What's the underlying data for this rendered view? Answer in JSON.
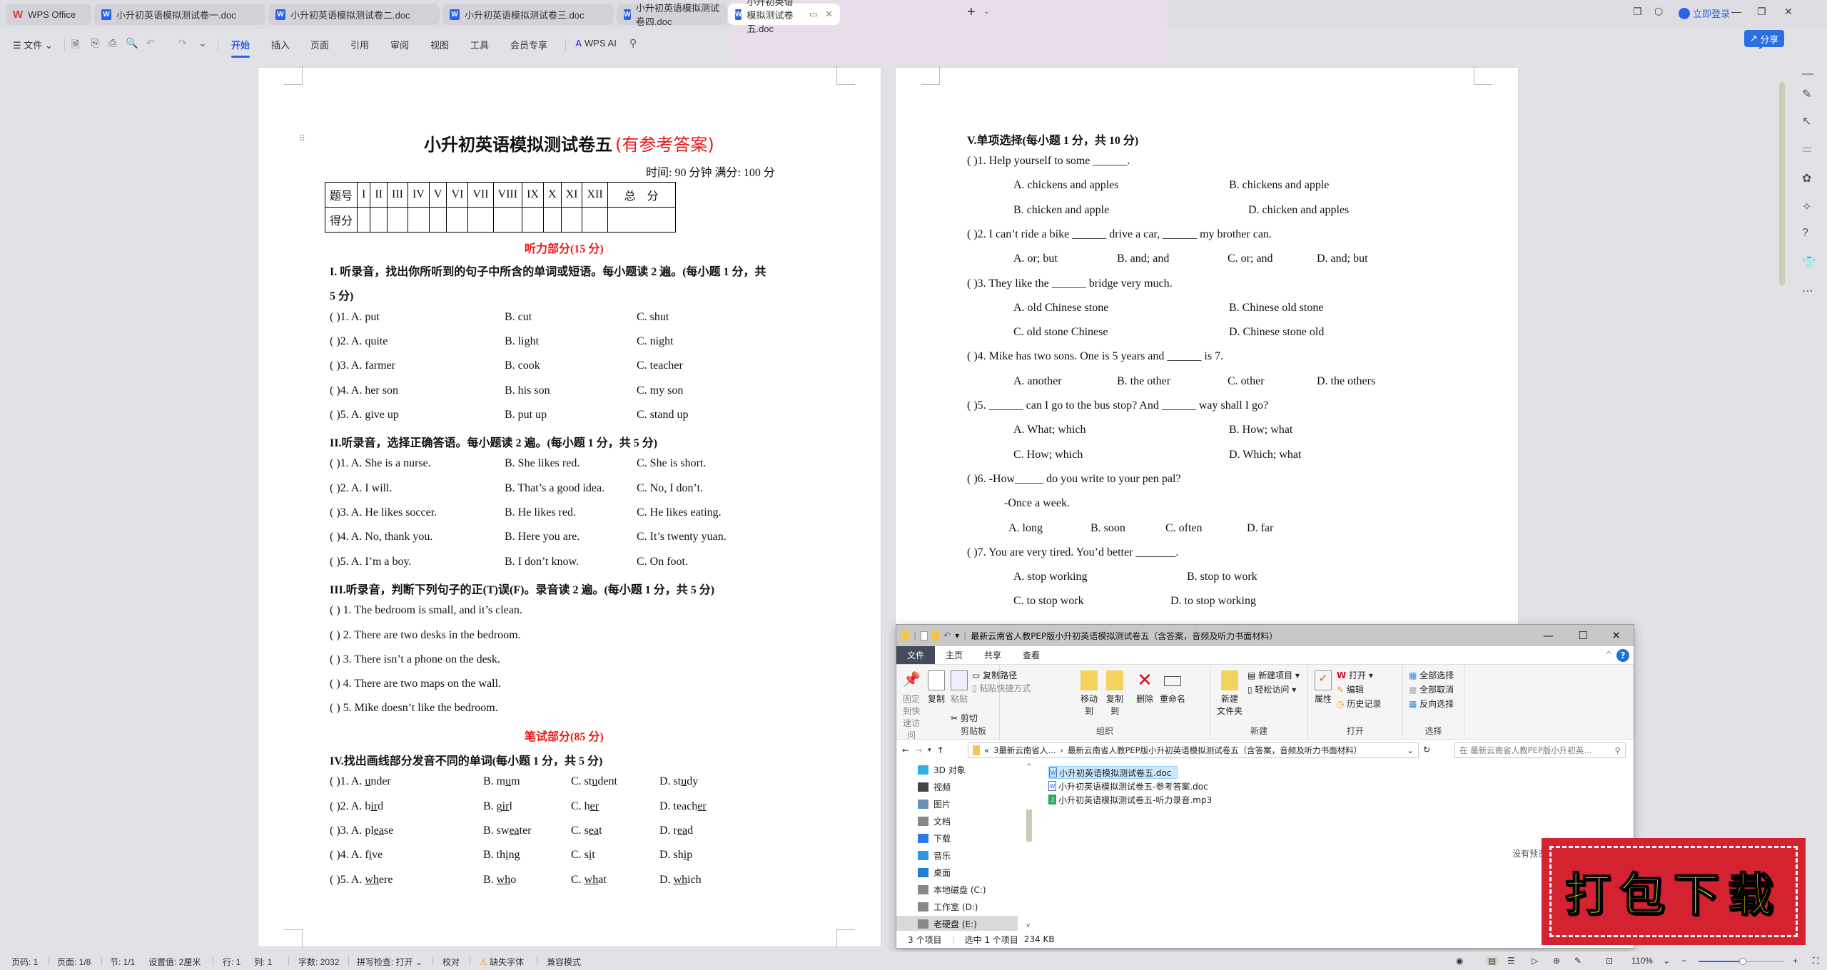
{
  "app": {
    "name": "WPS Office",
    "tabs": [
      {
        "label": "小升初英语模拟测试卷一.doc",
        "active": false
      },
      {
        "label": "小升初英语模拟测试卷二.doc",
        "active": false
      },
      {
        "label": "小升初英语模拟测试卷三.doc",
        "active": false
      },
      {
        "label": "小升初英语模拟测试卷四.doc",
        "active": false
      },
      {
        "label": "小升初英语模拟测试卷五.doc",
        "active": true
      }
    ],
    "login_label": "立即登录"
  },
  "ribbon": {
    "file_menu": "文件",
    "tabs": [
      "开始",
      "插入",
      "页面",
      "引用",
      "审阅",
      "视图",
      "工具",
      "会员专享"
    ],
    "active_tab": "开始",
    "wps_ai": "WPS AI",
    "share": "分享"
  },
  "doc": {
    "title": "小升初英语模拟测试卷五",
    "title_note": "(有参考答案)",
    "meta": "时间: 90 分钟      满分: 100 分",
    "score_table": {
      "row1": [
        "题号",
        "I",
        "II",
        "III",
        "IV",
        "V",
        "VI",
        "VII",
        "VIII",
        "IX",
        "X",
        "XI",
        "XII",
        "总　分"
      ],
      "row2_label": "得分"
    },
    "listening_header": "听力部分(15 分)",
    "sec1": {
      "heading_line1": "I. 听录音，找出你所听到的句子中所含的单词或短语。每小题读 2 遍。(每小题 1 分，共",
      "heading_line2": "5 分)",
      "items": [
        {
          "q": "(      )1. A. put",
          "b": "B. cut",
          "c": "C. shut"
        },
        {
          "q": "(      )2. A. quite",
          "b": "B. light",
          "c": "C. night"
        },
        {
          "q": "(      )3. A. farmer",
          "b": "B. cook",
          "c": "C. teacher"
        },
        {
          "q": "(      )4. A. her son",
          "b": "B. his son",
          "c": "C. my son"
        },
        {
          "q": "(      )5. A. give up",
          "b": "B. put up",
          "c": "C. stand up"
        }
      ]
    },
    "sec2": {
      "heading": "II.听录音，选择正确答语。每小题读 2 遍。(每小题 1 分，共 5 分)",
      "items": [
        {
          "q": "(      )1. A. She is a nurse.",
          "b": "B. She likes red.",
          "c": "C. She is short."
        },
        {
          "q": "(      )2. A. I will.",
          "b": "B. That’s a good idea.",
          "c": "C. No, I don’t."
        },
        {
          "q": "(      )3. A. He likes soccer.",
          "b": "B. He likes red.",
          "c": "C. He likes eating."
        },
        {
          "q": "(      )4. A. No, thank you.",
          "b": "B. Here you are.",
          "c": "C. It’s twenty yuan."
        },
        {
          "q": "(      )5. A. I’m a boy.",
          "b": "B. I don’t know.",
          "c": "C. On foot."
        }
      ]
    },
    "sec3": {
      "heading": "III.听录音，判断下列句子的正(T)误(F)。录音读 2 遍。(每小题 1 分，共 5 分)",
      "items": [
        "(      ) 1. The bedroom is small, and it’s clean.",
        "(      ) 2. There are two desks in the bedroom.",
        "(      ) 3. There isn’t a phone on the desk.",
        "(      ) 4. There are two maps on the wall.",
        "(      ) 5. Mike doesn’t like the bedroom."
      ]
    },
    "written_header": "笔试部分(85 分)",
    "sec4": {
      "heading": "IV.找出画线部分发音不同的单词(每小题 1 分，共 5 分)",
      "items": [
        {
          "q": "(      )1. A. ",
          "a": [
            "",
            "u",
            "nder"
          ],
          "b": [
            "B. m",
            "u",
            "m"
          ],
          "c": [
            "C. st",
            "u",
            "dent"
          ],
          "d": [
            "D. st",
            "u",
            "dy"
          ]
        },
        {
          "q": "(      )2. A. ",
          "a": [
            "b",
            "ir",
            "d"
          ],
          "b": [
            "B. g",
            "ir",
            "l"
          ],
          "c": [
            "C. h",
            "er",
            ""
          ],
          "d": [
            "D. teach",
            "er",
            ""
          ]
        },
        {
          "q": "(      )3. A. ",
          "a": [
            "pl",
            "ea",
            "se"
          ],
          "b": [
            "B. sw",
            "ea",
            "ter"
          ],
          "c": [
            "C. s",
            "ea",
            "t"
          ],
          "d": [
            "D. r",
            "ea",
            "d"
          ]
        },
        {
          "q": "(      )4. A. ",
          "a": [
            "f",
            "i",
            "ve"
          ],
          "b": [
            "B. th",
            "i",
            "ng"
          ],
          "c": [
            "C. s",
            "i",
            "t"
          ],
          "d": [
            "D. sh",
            "i",
            "p"
          ]
        },
        {
          "q": "(      )5. A. ",
          "a": [
            "",
            "wh",
            "ere"
          ],
          "b": [
            "B. ",
            "wh",
            "o"
          ],
          "c": [
            "C. ",
            "wh",
            "at"
          ],
          "d": [
            "D. ",
            "wh",
            "ich"
          ]
        }
      ]
    },
    "sec5": {
      "heading": "V.单项选择(每小题 1 分，共 10 分)",
      "lines": [
        {
          "t": "(      )1. Help yourself to some ______.",
          "indent": 0
        },
        {
          "t": "A.  chickens and apples",
          "t2": "B. chickens and apple",
          "indent": 1
        },
        {
          "t": "B.  chicken and apple",
          "t2": "D. chicken and apples",
          "indent": 1,
          "shift": true
        },
        {
          "t": "(      )2. I can’t ride a bike ______ drive a car, ______ my brother can.",
          "indent": 0
        },
        {
          "t4": [
            "A.  or; but",
            "B. and; and",
            "C. or; and",
            "D. and; but"
          ],
          "indent": 1
        },
        {
          "t": "(      )3. They like the ______ bridge very much.",
          "indent": 0
        },
        {
          "t": "A.  old Chinese stone",
          "t2": "B. Chinese old stone",
          "indent": 1
        },
        {
          "t": "C. old stone Chinese",
          "t2": "D. Chinese stone old",
          "indent": 1
        },
        {
          "t": "(      )4. Mike has two sons. One is 5 years and ______ is 7.",
          "indent": 0
        },
        {
          "t4": [
            "A.  another",
            "B. the other",
            "C. other",
            "D. the others"
          ],
          "indent": 1
        },
        {
          "t": "(      )5. ______ can I go to the bus stop?    And ______ way shall I go?",
          "indent": 0
        },
        {
          "t": "A.  What;   which",
          "t2": "B. How;   what",
          "indent": 1
        },
        {
          "t": "C. How;   which",
          "t2": "D. Which;   what",
          "indent": 1
        },
        {
          "t": "(      )6. -How_____ do you write to your pen pal?",
          "indent": 0
        },
        {
          "t": "-Once a week.",
          "indent": 2
        },
        {
          "t4": [
            "A. long",
            "B. soon",
            "C. often",
            "D. far"
          ],
          "indent": 3
        },
        {
          "t": "(      )7. You are very tired. You’d better _______.",
          "indent": 0
        },
        {
          "t": "A.  stop working",
          "t2": "B. stop to work",
          "indent": 1,
          "narrow": true
        },
        {
          "t": "C. to stop work",
          "t2": "D. to stop working",
          "indent": 1,
          "narrow2": true
        }
      ]
    }
  },
  "explorer": {
    "title": "最新云南省人教PEP版小升初英语模拟测试卷五（含答案，音频及听力书面材料）",
    "menu": [
      "文件",
      "主页",
      "共享",
      "查看"
    ],
    "ribbon": {
      "clipboard": {
        "label": "剪贴板",
        "pin": "固定到快速访问",
        "copy": "复制",
        "paste": "粘贴",
        "copy_path": "复制路径",
        "paste_shortcut": "粘贴快捷方式",
        "cut": "剪切"
      },
      "organize": {
        "label": "组织",
        "move_to": "移动到",
        "copy_to": "复制到",
        "delete": "删除",
        "rename": "重命名"
      },
      "new": {
        "label": "新建",
        "new_folder": "新建\n文件夹",
        "new_item": "新建项目",
        "easy_access": "轻松访问"
      },
      "open": {
        "label": "打开",
        "properties": "属性",
        "open": "打开",
        "edit": "编辑",
        "history": "历史记录"
      },
      "select": {
        "label": "选择",
        "select_all": "全部选择",
        "select_none": "全部取消",
        "invert": "反向选择"
      }
    },
    "address": {
      "part1": "3最新云南省人...",
      "part2": "最新云南省人教PEP版小升初英语模拟测试卷五（含答案，音频及听力书面材料）"
    },
    "search_placeholder": "在 最新云南省人教PEP版小升初英...",
    "nav": [
      "3D 对象",
      "视频",
      "图片",
      "文档",
      "下载",
      "音乐",
      "桌面",
      "本地磁盘 (C:)",
      "工作室 (D:)",
      "老硬盘 (E:)"
    ],
    "files": [
      {
        "name": "小升初英语模拟测试卷五.doc",
        "type": "doc",
        "selected": true
      },
      {
        "name": "小升初英语模拟测试卷五-参考答案.doc",
        "type": "doc",
        "selected": false
      },
      {
        "name": "小升初英语模拟测试卷五-听力录音.mp3",
        "type": "mp3",
        "selected": false
      }
    ],
    "no_preview": "没有预览。",
    "status": {
      "count": "3 个项目",
      "selected": "选中 1 个项目",
      "size": "234 KB"
    }
  },
  "stamp": {
    "text": "打包下载"
  },
  "statusbar": {
    "page_no": "页码: 1",
    "pages": "页面: 1/8",
    "section": "节: 1/1",
    "setting": "设置值: 2厘米",
    "row": "行: 1",
    "col": "列: 1",
    "words": "字数: 2032",
    "spell": "拼写检查: 打开",
    "proof": "校对",
    "missing_font": "缺失字体",
    "compat": "兼容模式",
    "zoom": "110%",
    "zoom_fraction": 0.52
  }
}
